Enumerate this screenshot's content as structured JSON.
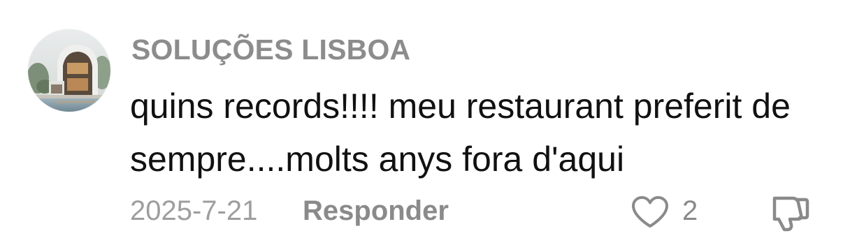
{
  "comment": {
    "author": "SOLUÇÕES LISBOA",
    "text": "quins records!!!! meu restaurant preferit de sempre....molts anys fora d'aqui",
    "date": "2025-7-21",
    "reply_label": "Responder",
    "like_count": "2",
    "avatar_icon": "avatar-photo",
    "like_icon": "heart-icon",
    "dislike_icon": "thumbs-down-icon"
  },
  "colors": {
    "author": "#8c8c8c",
    "text": "#111111",
    "meta": "#9e9e9e",
    "icon": "#8a8a8a"
  }
}
